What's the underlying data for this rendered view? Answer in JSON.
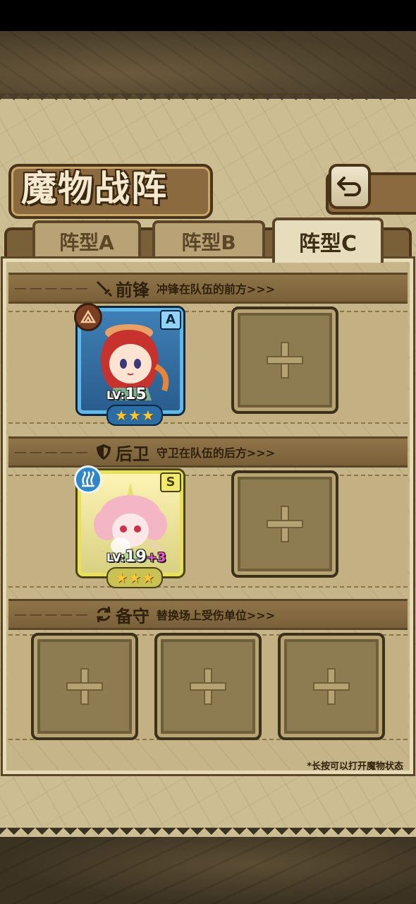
{
  "screen": {
    "title": "魔物战阵",
    "back_icon": "back-arrow-icon"
  },
  "tabs": [
    {
      "label": "阵型A",
      "active": false
    },
    {
      "label": "阵型B",
      "active": false
    },
    {
      "label": "阵型C",
      "active": true
    }
  ],
  "sections": {
    "front": {
      "name": "前锋",
      "desc": "冲锋在队伍的前方>>>",
      "icon": "sword-icon"
    },
    "rear": {
      "name": "后卫",
      "desc": "守卫在队伍的后方>>>",
      "icon": "shield-icon"
    },
    "reserve": {
      "name": "备守",
      "desc": "替换场上受伤单位>>>",
      "icon": "swap-icon"
    }
  },
  "units": {
    "front_unit": {
      "grade": "A",
      "level_prefix": "LV:",
      "level": "15",
      "bonus": "",
      "stars": 3,
      "element": "earth-element-icon",
      "accent": "#5fb8e8"
    },
    "rear_unit": {
      "grade": "S",
      "level_prefix": "LV:",
      "level": "19",
      "bonus": "+3",
      "stars": 3,
      "element": "water-element-icon",
      "accent": "#e8e05a"
    }
  },
  "footnote": "*长按可以打开魔物状态"
}
